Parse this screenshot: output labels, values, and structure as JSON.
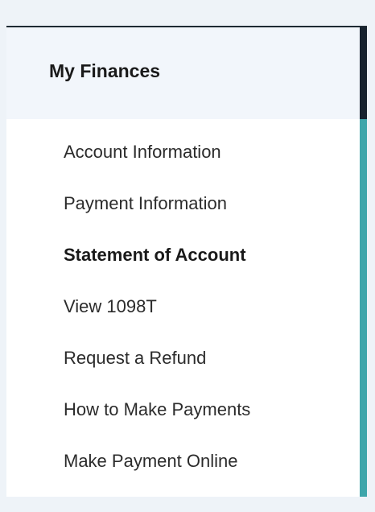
{
  "panel": {
    "title": "My Finances",
    "items": [
      {
        "label": "Account Information",
        "active": false
      },
      {
        "label": "Payment Information",
        "active": false
      },
      {
        "label": "Statement of Account",
        "active": true
      },
      {
        "label": "View 1098T",
        "active": false
      },
      {
        "label": "Request a Refund",
        "active": false
      },
      {
        "label": "How to Make Payments",
        "active": false
      },
      {
        "label": "Make Payment Online",
        "active": false
      }
    ]
  },
  "colors": {
    "page_background": "#eef3f8",
    "header_background": "#f2f6fb",
    "accent_dark": "#16222e",
    "accent_teal": "#3ea6ab",
    "text": "#2b2b2b"
  }
}
